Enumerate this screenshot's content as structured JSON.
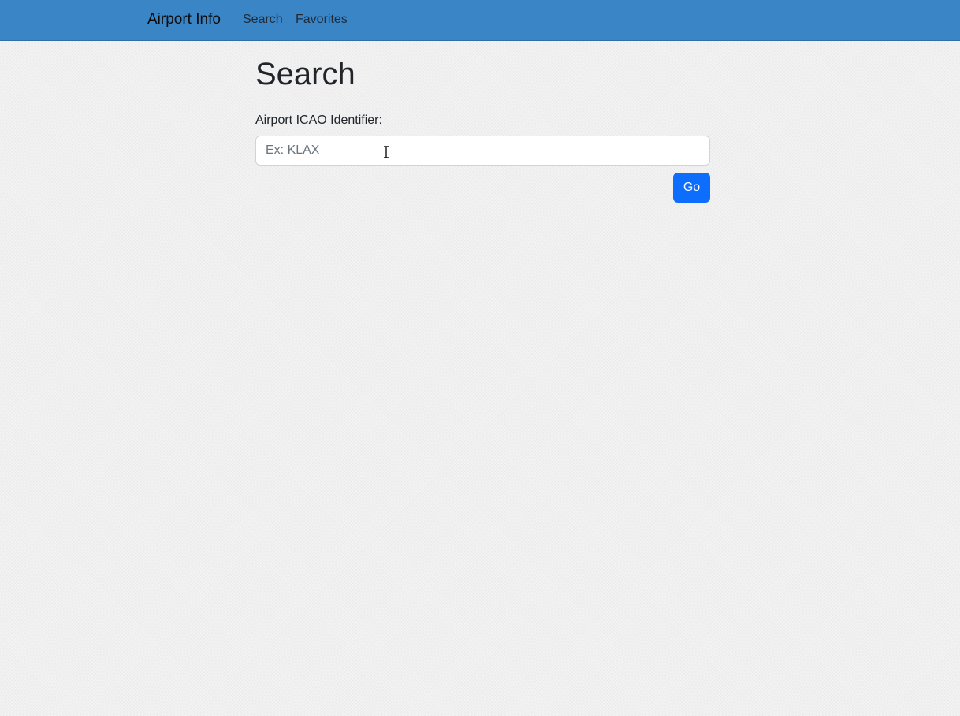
{
  "navbar": {
    "brand": "Airport Info",
    "links": [
      {
        "label": "Search"
      },
      {
        "label": "Favorites"
      }
    ],
    "background_color": "#3a85c6"
  },
  "main": {
    "title": "Search",
    "form": {
      "label": "Airport ICAO Identifier:",
      "input_value": "",
      "input_placeholder": "Ex: KLAX",
      "submit_label": "Go",
      "submit_color": "#0d6efd"
    }
  },
  "icons": {
    "text_cursor": "i-beam-cursor-icon"
  }
}
